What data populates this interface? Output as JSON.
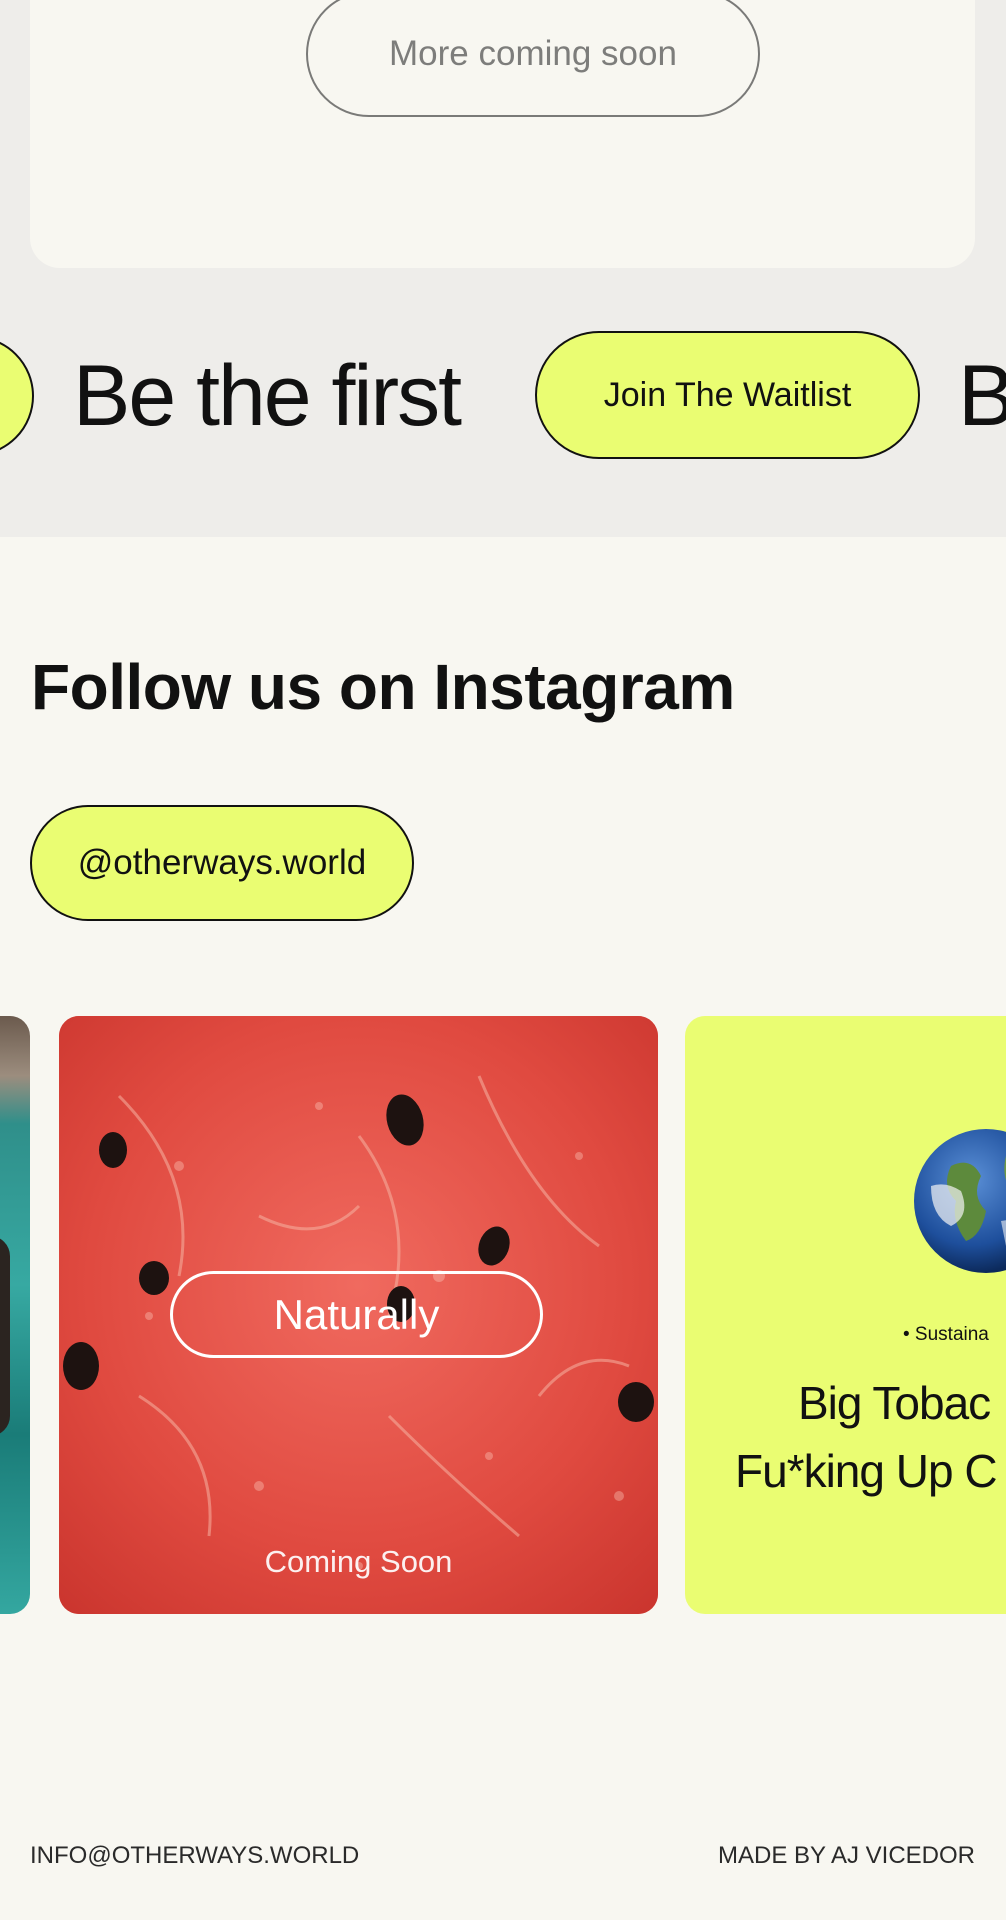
{
  "colors": {
    "background": "#f8f7f1",
    "band": "#eeedea",
    "accent_lime": "#eafd72",
    "text": "#111111",
    "watermelon": "#e24b42"
  },
  "more": {
    "label": "More coming soon"
  },
  "marquee": {
    "headline": "Be the first",
    "waitlist_label": "Join The Waitlist",
    "next_headline_fragment": "B"
  },
  "instagram": {
    "heading": "Follow us on Instagram",
    "handle": "@otherways.world",
    "tiles": [
      {
        "kind": "photo",
        "icon": "pool-photo"
      },
      {
        "kind": "photo",
        "icon": "watermelon-photo",
        "badge": "Naturally",
        "caption": "Coming Soon"
      },
      {
        "kind": "graphic",
        "icon": "globe-icon",
        "tag": "• Sustaina",
        "line1": "Big Tobac",
        "line2": "Fu*king Up C"
      }
    ]
  },
  "footer": {
    "email": "INFO@OTHERWAYS.WORLD",
    "credit": "MADE BY AJ VICEDOR"
  }
}
